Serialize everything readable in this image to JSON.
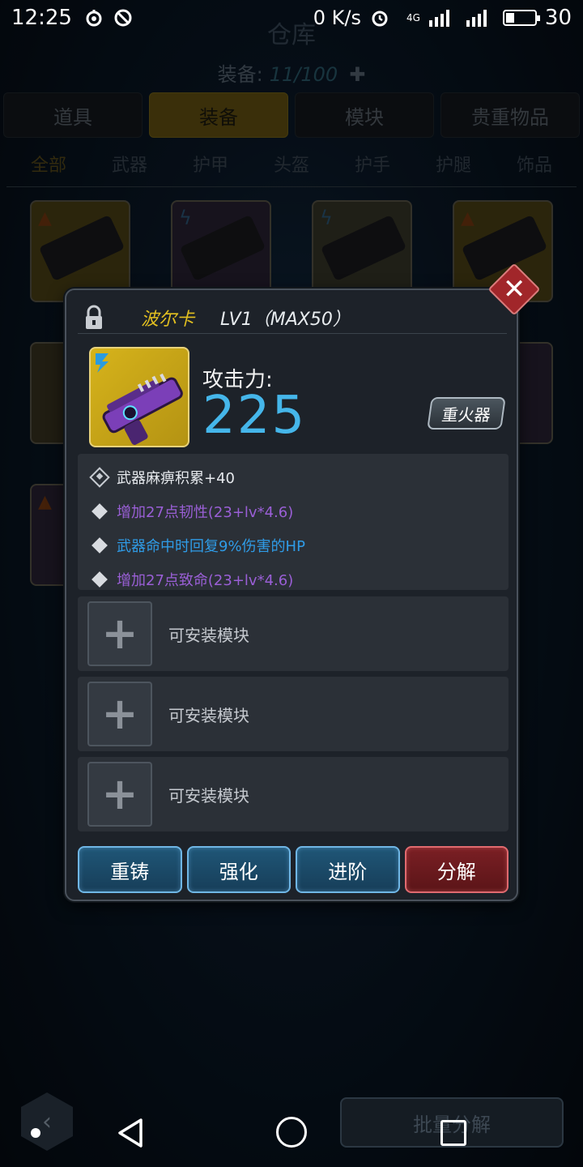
{
  "status_bar": {
    "time": "12:25",
    "net_speed": "0 K/s",
    "network": "4G",
    "battery": "30"
  },
  "warehouse": {
    "title": "仓库",
    "equip_label": "装备:",
    "equip_count": "11/100"
  },
  "tabs": [
    {
      "label": "道具",
      "active": false
    },
    {
      "label": "装备",
      "active": true
    },
    {
      "label": "模块",
      "active": false
    },
    {
      "label": "贵重物品",
      "active": false
    }
  ],
  "subtabs": [
    {
      "label": "全部",
      "active": true
    },
    {
      "label": "武器",
      "active": false
    },
    {
      "label": "护甲",
      "active": false
    },
    {
      "label": "头盔",
      "active": false
    },
    {
      "label": "护手",
      "active": false
    },
    {
      "label": "护腿",
      "active": false
    },
    {
      "label": "饰品",
      "active": false
    }
  ],
  "modal": {
    "item_name": "波尔卡",
    "level": "LV1（MAX50）",
    "attack_label": "攻击力:",
    "attack_value": "225",
    "weapon_type": "重火器",
    "attributes": [
      {
        "text": "武器麻痹积累+40",
        "color": "#e6e9ed",
        "icon": "module-icon"
      },
      {
        "text": "增加27点韧性(23+lv*4.6)",
        "color": "#9a5fd6",
        "icon": "diamond-icon"
      },
      {
        "text": "武器命中时回复9%伤害的HP",
        "color": "#2f9be6",
        "icon": "diamond-icon"
      },
      {
        "text": "增加27点致命(23+lv*4.6)",
        "color": "#9a5fd6",
        "icon": "diamond-icon"
      }
    ],
    "slots": [
      {
        "label": "可安装模块"
      },
      {
        "label": "可安装模块"
      },
      {
        "label": "可安装模块"
      }
    ],
    "buttons": {
      "recast": "重铸",
      "enhance": "强化",
      "advance": "进阶",
      "decompose": "分解"
    }
  },
  "bottom": {
    "batch_decompose": "批量分解"
  },
  "colors": {
    "accent_gold": "#e3c020",
    "attack_blue": "#45b6ea",
    "btn_blue": "#1f5677",
    "btn_red": "#7a1f24"
  }
}
